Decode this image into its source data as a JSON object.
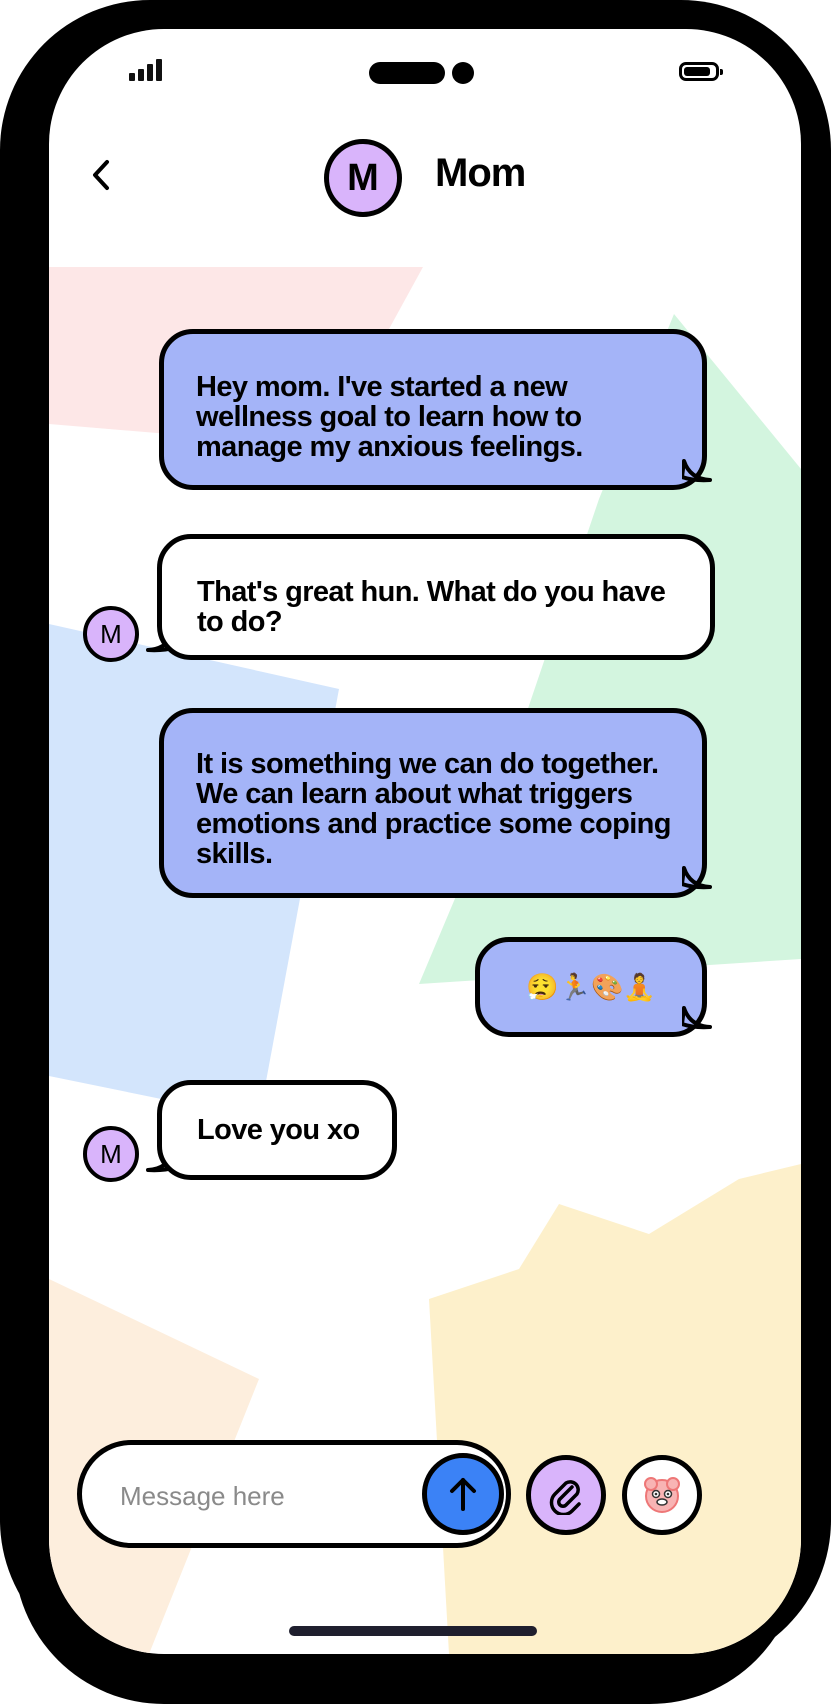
{
  "header": {
    "contact_initial": "M",
    "contact_name": "Mom"
  },
  "messages": [
    {
      "direction": "outgoing",
      "text": "Hey mom. I've started a new wellness goal to learn how to manage my anxious feelings."
    },
    {
      "direction": "incoming",
      "avatar": "M",
      "text": "That's great hun. What do you have to do?"
    },
    {
      "direction": "outgoing",
      "text": "It is something we can do together. We can learn about what triggers emotions and practice some coping skills."
    },
    {
      "direction": "outgoing",
      "text": "😮‍💨🏃🎨🧘"
    },
    {
      "direction": "incoming",
      "avatar": "M",
      "text": "Love you xo"
    }
  ],
  "composer": {
    "placeholder": "Message here"
  },
  "icons": {
    "back": "chevron-left-icon",
    "send": "arrow-up-icon",
    "attach": "paperclip-icon",
    "sticker": "sticker-face-icon",
    "signal": "signal-bars-icon",
    "battery": "battery-icon"
  },
  "colors": {
    "outgoing_bubble": "#a4b4f8",
    "incoming_bubble": "#ffffff",
    "avatar": "#d9b4fb",
    "send_button": "#3b82f6"
  }
}
